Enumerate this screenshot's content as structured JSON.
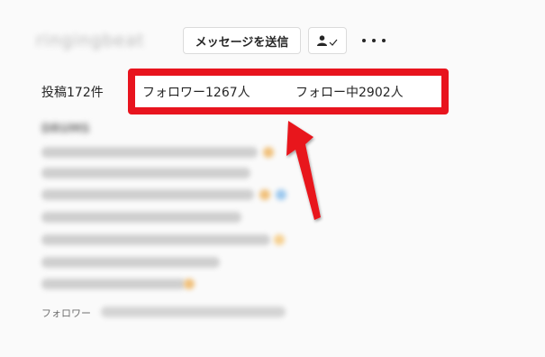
{
  "profile": {
    "username_blurred": "ringingbeat",
    "message_button": "メッセージを送信",
    "posts_label": "投稿172件",
    "followers_label": "フォロワー1267人",
    "following_label": "フォロー中2902人",
    "bio_name_blurred": "DRUMS",
    "footer_label": "フォロワー"
  },
  "icons": {
    "follow_state": "person-check-icon",
    "more": "more-options-icon",
    "annotation_arrow": "red-arrow-icon"
  },
  "colors": {
    "highlight": "#e8141e",
    "background": "#fafafa"
  }
}
